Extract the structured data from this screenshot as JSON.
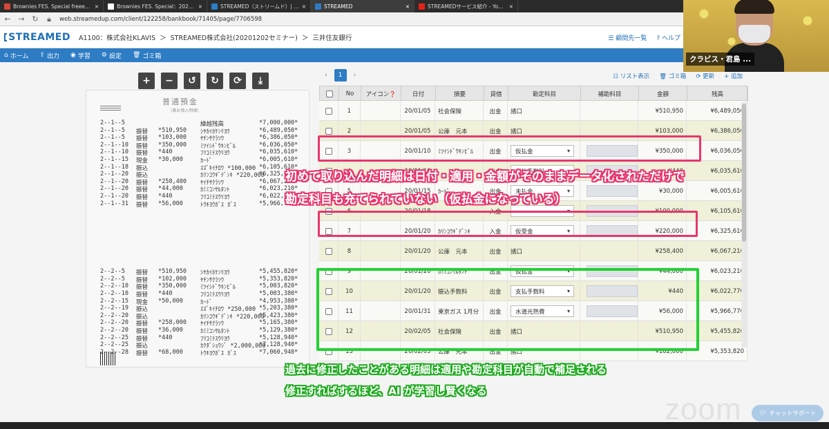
{
  "browser": {
    "tabs": [
      {
        "label": "Brownies FES. Special freee ＋ ...",
        "icon": "gmail-icon",
        "color": "#d44638",
        "active": false
      },
      {
        "label": "Brownies FES. Special：2020-12",
        "icon": "checkbox-icon",
        "color": "#ffffff",
        "active": false
      },
      {
        "label": "STREAMED（ストリームド）| スキャ...",
        "icon": "streamed-icon",
        "color": "#2d7cc4",
        "active": false
      },
      {
        "label": "STREAMED",
        "icon": "streamed-icon",
        "color": "#2d7cc4",
        "active": true
      },
      {
        "label": "STREAMEDサービス紹介 - YouTube",
        "icon": "youtube-icon",
        "color": "#e62117",
        "active": false
      }
    ],
    "url": "web.streamedup.com/client/122258/bankbook/71405/page/7706598"
  },
  "app": {
    "logo": "STREAMED",
    "breadcrumb": [
      "A1100：株式会社KLAVIS",
      "＞",
      "STREAMED株式会社(20201202セミナー)",
      "＞",
      "三井住友銀行"
    ],
    "header_links": [
      "顧問先一覧",
      "ヘルプ"
    ],
    "nav": [
      "ホーム",
      "出力",
      "学習",
      "設定",
      "ゴミ箱"
    ]
  },
  "toolbar": {
    "buttons": [
      {
        "name": "zoom-in-button",
        "glyph": "+"
      },
      {
        "name": "zoom-out-button",
        "glyph": "−"
      },
      {
        "name": "rotate-left-button",
        "glyph": "↺"
      },
      {
        "name": "rotate-right-button",
        "glyph": "↻"
      },
      {
        "name": "refresh-button",
        "glyph": "⟳"
      },
      {
        "name": "download-button",
        "glyph": "⤓"
      }
    ]
  },
  "passbook": {
    "title": "普通預金",
    "subtitle": "(兼お預入明細)",
    "rows": [
      {
        "date": "2--1--5",
        "kind": "",
        "amount": "",
        "memo": "繰越残高",
        "balance": "*7,000,000*"
      },
      {
        "date": "2--1--5",
        "kind": "振替",
        "amount": "*510,950",
        "memo": "ｼﾔｶｲﾎｹﾝﾘﾖｳ",
        "balance": "*6,489,050*"
      },
      {
        "date": "2--1--5",
        "kind": "振替",
        "amount": "*103,000",
        "memo": "ﾔﾁﾝｻｸﾗｿｳ",
        "balance": "*6,386,050*"
      },
      {
        "date": "2--1--10",
        "kind": "振替",
        "amount": "*350,000",
        "memo": "ﾐﾂｲｼﾄﾞｳｷﾝﾋﾞﾙ",
        "balance": "*6,036,050*"
      },
      {
        "date": "2--1--10",
        "kind": "振替",
        "amount": "*440",
        "memo": "ﾌﾘｺﾐﾃｽｳﾘﾖｳ",
        "balance": "*6,035,610*"
      },
      {
        "date": "2--1--15",
        "kind": "現金",
        "amount": "*30,000",
        "memo": "ｶｰﾄﾞ",
        "balance": "*6,005,610*"
      },
      {
        "date": "2--1--18",
        "kind": "振込",
        "amount": "",
        "memo": "ｽｽﾞｷｲﾁﾛｳ *100,000",
        "balance": "*6,105,610*"
      },
      {
        "date": "2--1--20",
        "kind": "振込",
        "amount": "",
        "memo": "ｶﾘﾝｺｳｷﾞﾃﾞﾝｷ *220,000",
        "balance": "*6,325,610*"
      },
      {
        "date": "2--1--20",
        "kind": "振替",
        "amount": "*258,400",
        "memo": "ﾔｲﾁｻｸﾗｿｳ",
        "balance": "*6,067,210*"
      },
      {
        "date": "2--1--20",
        "kind": "振替",
        "amount": "*44,000",
        "memo": "ｶﾐﾐｺﾝｻﾙﾀﾝﾄ",
        "balance": "*6,023,210*"
      },
      {
        "date": "2--1--20",
        "kind": "振替",
        "amount": "*440",
        "memo": "ﾌﾘｺﾐﾃｽｳﾘﾖｳ",
        "balance": "*6,022,770*"
      },
      {
        "date": "2--1--31",
        "kind": "振替",
        "amount": "*56,000",
        "memo": "ﾄｳｷﾖｳｶﾞｽ ｶﾞｽ",
        "balance": "*5,966,770*"
      },
      {
        "date": "2--2--5",
        "kind": "振替",
        "amount": "*510,950",
        "memo": "ｼﾔｶｲﾎｹﾝﾘﾖｳ",
        "balance": "*5,455,820*"
      },
      {
        "date": "2--2--5",
        "kind": "振替",
        "amount": "*102,000",
        "memo": "ﾔﾁﾝｻｸﾗｿｳ",
        "balance": "*5,353,820*"
      },
      {
        "date": "2--2--10",
        "kind": "振替",
        "amount": "*350,000",
        "memo": "ﾐﾂｲｼﾄﾞｳｷﾝﾋﾞﾙ",
        "balance": "*5,003,820*"
      },
      {
        "date": "2--2--10",
        "kind": "振替",
        "amount": "*440",
        "memo": "ﾌﾘｺﾐﾃｽｳﾘﾖｳ",
        "balance": "*5,003,380*"
      },
      {
        "date": "2--2--15",
        "kind": "現金",
        "amount": "*50,000",
        "memo": "ｶｰﾄﾞ",
        "balance": "*4,953,380*"
      },
      {
        "date": "2--2--19",
        "kind": "振込",
        "amount": "",
        "memo": "ｽｽﾞｷｲﾁﾛｳ *250,000",
        "balance": "*5,203,380*"
      },
      {
        "date": "2--2--20",
        "kind": "振込",
        "amount": "",
        "memo": "ｶﾘﾝｺｳｷﾞﾃﾞﾝｷ *220,000",
        "balance": "*5,423,380*"
      },
      {
        "date": "2--2--20",
        "kind": "振替",
        "amount": "*258,000",
        "memo": "ﾔｲﾁｻｸﾗｿｳ",
        "balance": "*5,165,380*"
      },
      {
        "date": "2--2--20",
        "kind": "振替",
        "amount": "*36,000",
        "memo": "ｶﾐﾐｺﾝｻﾙﾀﾝﾄ",
        "balance": "*5,129,380*"
      },
      {
        "date": "2--2--25",
        "kind": "振替",
        "amount": "*440",
        "memo": "ﾌﾘｺﾐﾃｽｳﾘﾖｳ",
        "balance": "*5,128,940*"
      },
      {
        "date": "2--2--25",
        "kind": "振込",
        "amount": "",
        "memo": "ｶｸﾀﾞｼｮｳｼﾞ *2,000,000",
        "balance": "*7,128,940*"
      },
      {
        "date": "2--2--28",
        "kind": "振替",
        "amount": "*68,000",
        "memo": "ﾄｳｷﾖｳｶﾞｽ ｶﾞｽ",
        "balance": "*7,060,940*"
      }
    ]
  },
  "pager": {
    "prev": "‹",
    "page": "1",
    "next": "›"
  },
  "table_actions": [
    "リスト表示",
    "ゴミ箱",
    "更新",
    "追加"
  ],
  "table": {
    "headers": [
      "",
      "No",
      "アイコン",
      "日付",
      "摘要",
      "貸借",
      "勘定科目",
      "補助科目",
      "金額",
      "残高"
    ],
    "rows": [
      {
        "no": "1",
        "date": "20/01/05",
        "memo": "社会保険",
        "dir": "出金",
        "account": "諸口",
        "select": false,
        "amount": "¥510,950",
        "balance": "¥6,489,050"
      },
      {
        "no": "2",
        "date": "20/01/05",
        "memo": "公庫　元本",
        "dir": "出金",
        "account": "諸口",
        "select": false,
        "amount": "¥103,000",
        "balance": "¥6,386,050"
      },
      {
        "no": "3",
        "date": "20/01/10",
        "memo": "ﾐﾂｲｼﾄﾞｳｷﾝﾋﾞﾙ",
        "dir": "出金",
        "account": "仮払金",
        "select": true,
        "amount": "¥350,000",
        "balance": "¥6,036,050"
      },
      {
        "no": "4",
        "date": "20/01/10",
        "memo": "",
        "dir": "出金",
        "account": "支払手数料",
        "select": true,
        "amount": "¥440",
        "balance": "¥6,035,610"
      },
      {
        "no": "5",
        "date": "20/01/15",
        "memo": "ｶｰﾄﾞ",
        "dir": "出金",
        "account": "未払金",
        "select": true,
        "amount": "¥30,000",
        "balance": "¥6,005,610"
      },
      {
        "no": "6",
        "date": "20/01/18",
        "memo": "",
        "dir": "入金",
        "account": "",
        "select": true,
        "amount": "¥100,000",
        "balance": "¥6,105,610"
      },
      {
        "no": "7",
        "date": "20/01/20",
        "memo": "ｶﾘﾝｺｳｷﾞﾃﾞﾝｷ",
        "dir": "入金",
        "account": "仮受金",
        "select": true,
        "amount": "¥220,000",
        "balance": "¥6,325,610"
      },
      {
        "no": "8",
        "date": "20/01/20",
        "memo": "公庫　元本",
        "dir": "出金",
        "account": "諸口",
        "select": false,
        "amount": "¥258,400",
        "balance": "¥6,067,210"
      },
      {
        "no": "9",
        "date": "20/01/20",
        "memo": "ｶﾐﾐｺﾝｻﾙﾀﾝﾄ",
        "dir": "出金",
        "account": "仮払金",
        "select": true,
        "amount": "¥44,000",
        "balance": "¥6,023,210"
      },
      {
        "no": "10",
        "date": "20/01/20",
        "memo": "振込手数料",
        "dir": "出金",
        "account": "支払手数料",
        "select": true,
        "amount": "¥440",
        "balance": "¥6,022,770"
      },
      {
        "no": "11",
        "date": "20/01/31",
        "memo": "東京ガス 1月分",
        "dir": "出金",
        "account": "水道光熱費",
        "select": true,
        "amount": "¥56,000",
        "balance": "¥5,966,770"
      },
      {
        "no": "12",
        "date": "20/02/05",
        "memo": "社会保険",
        "dir": "出金",
        "account": "諸口",
        "select": false,
        "amount": "¥510,950",
        "balance": "¥5,455,820"
      },
      {
        "no": "13",
        "date": "20/02/05",
        "memo": "公庫　元本",
        "dir": "出金",
        "account": "諸口",
        "select": false,
        "amount": "¥102,000",
        "balance": "¥5,353,820"
      }
    ]
  },
  "captions": {
    "pink_line1": "初めて取り込んだ明細は日付・適用・金額がそのままデータ化されただけで",
    "pink_line2": "勘定科目も充てられていない（仮払金になっている）",
    "green_line1": "過去に修正したことがある明細は適用や勘定科目が自動で補足される",
    "green_line2": "修正すればするほど、AI が学習し賢くなる"
  },
  "webcam": {
    "name": "クラビス・君島 ..."
  },
  "zoom": {
    "watermark": "zoom",
    "chat_button": "チャットサポート"
  },
  "colors": {
    "brand": "#2d7cc4",
    "highlight_pink": "#e8356d",
    "highlight_green": "#22d233",
    "row_yellow": "#f1f0d8"
  }
}
